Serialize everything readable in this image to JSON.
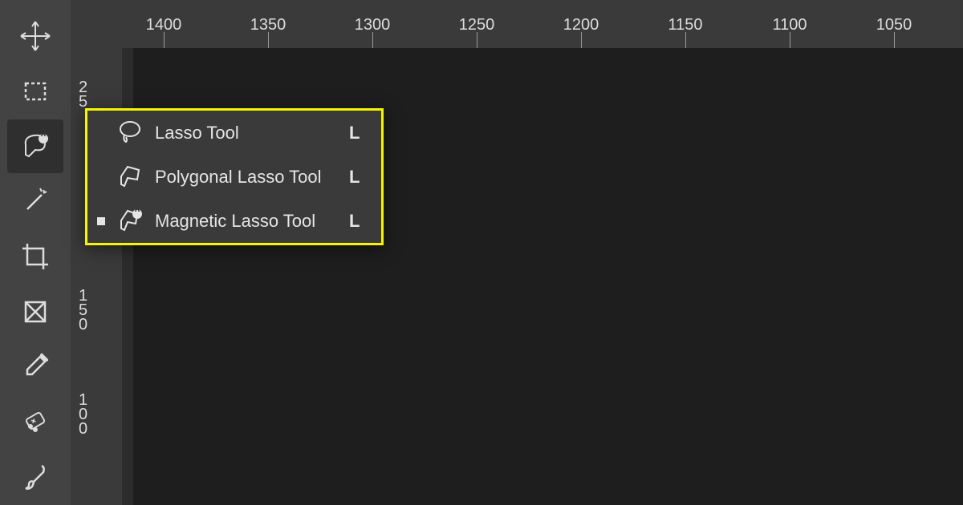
{
  "toolbar": {
    "tools": [
      {
        "name": "move",
        "active": false
      },
      {
        "name": "marquee",
        "active": false
      },
      {
        "name": "lasso",
        "active": true
      },
      {
        "name": "magic-wand",
        "active": false
      },
      {
        "name": "crop",
        "active": false
      },
      {
        "name": "frame",
        "active": false
      },
      {
        "name": "eyedropper",
        "active": false
      },
      {
        "name": "healing-brush",
        "active": false
      },
      {
        "name": "brush",
        "active": false
      }
    ]
  },
  "ruler": {
    "horizontal": [
      "1400",
      "1350",
      "1300",
      "1250",
      "1200",
      "1150",
      "1100",
      "1050"
    ],
    "vertical": [
      "25",
      "150",
      "100"
    ]
  },
  "flyout": {
    "items": [
      {
        "label": "Lasso Tool",
        "shortcut": "L",
        "icon": "lasso",
        "selected": false
      },
      {
        "label": "Polygonal Lasso Tool",
        "shortcut": "L",
        "icon": "polygonal-lasso",
        "selected": false
      },
      {
        "label": "Magnetic Lasso Tool",
        "shortcut": "L",
        "icon": "magnetic-lasso",
        "selected": true
      }
    ]
  },
  "colors": {
    "highlight": "#f5f500",
    "panel": "#434343",
    "canvas": "#1e1e1e"
  }
}
